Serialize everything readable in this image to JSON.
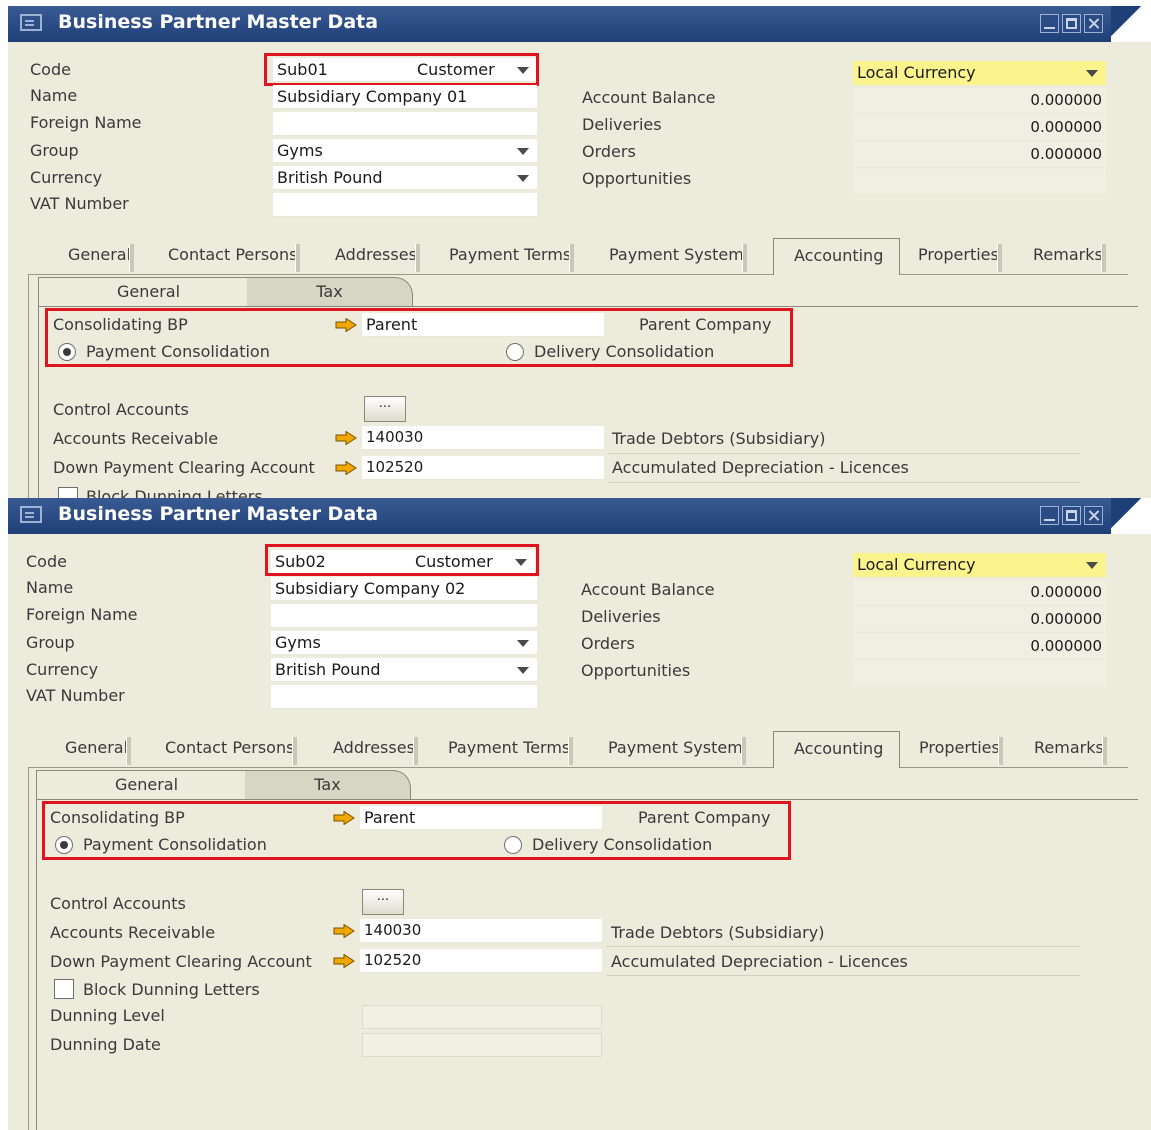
{
  "windows": [
    {
      "title": "Business Partner Master Data",
      "header": {
        "code_label": "Code",
        "code_value": "Sub01",
        "code_type": "Customer",
        "name_label": "Name",
        "name_value": "Subsidiary Company 01",
        "foreign_name_label": "Foreign Name",
        "foreign_name_value": "",
        "group_label": "Group",
        "group_value": "Gyms",
        "currency_label": "Currency",
        "currency_value": "British Pound",
        "vat_label": "VAT Number",
        "vat_value": "",
        "local_currency": "Local Currency",
        "account_balance_label": "Account Balance",
        "account_balance": "0.000000",
        "deliveries_label": "Deliveries",
        "deliveries": "0.000000",
        "orders_label": "Orders",
        "orders": "0.000000",
        "opportunities_label": "Opportunities",
        "opportunities": ""
      },
      "tabs": [
        "General",
        "Contact Persons",
        "Addresses",
        "Payment Terms",
        "Payment System",
        "Accounting",
        "Properties",
        "Remarks"
      ],
      "active_tab": "Accounting",
      "subtabs": [
        "General",
        "Tax"
      ],
      "consolidating": {
        "label": "Consolidating BP",
        "value": "Parent",
        "name": "Parent Company",
        "payment_label": "Payment Consolidation",
        "delivery_label": "Delivery Consolidation",
        "selected": "payment"
      },
      "control_accounts": {
        "label": "Control Accounts",
        "button": "...",
        "ar_label": "Accounts Receivable",
        "ar_value": "140030",
        "ar_desc": "Trade Debtors (Subsidiary)",
        "dp_label": "Down Payment Clearing Account",
        "dp_value": "102520",
        "dp_desc": "Accumulated Depreciation - Licences"
      },
      "block_dunning_label": "Block Dunning Letters"
    },
    {
      "title": "Business Partner Master Data",
      "header": {
        "code_label": "Code",
        "code_value": "Sub02",
        "code_type": "Customer",
        "name_label": "Name",
        "name_value": "Subsidiary Company 02",
        "foreign_name_label": "Foreign Name",
        "foreign_name_value": "",
        "group_label": "Group",
        "group_value": "Gyms",
        "currency_label": "Currency",
        "currency_value": "British Pound",
        "vat_label": "VAT Number",
        "vat_value": "",
        "local_currency": "Local Currency",
        "account_balance_label": "Account Balance",
        "account_balance": "0.000000",
        "deliveries_label": "Deliveries",
        "deliveries": "0.000000",
        "orders_label": "Orders",
        "orders": "0.000000",
        "opportunities_label": "Opportunities",
        "opportunities": ""
      },
      "tabs": [
        "General",
        "Contact Persons",
        "Addresses",
        "Payment Terms",
        "Payment System",
        "Accounting",
        "Properties",
        "Remarks"
      ],
      "active_tab": "Accounting",
      "subtabs": [
        "General",
        "Tax"
      ],
      "consolidating": {
        "label": "Consolidating BP",
        "value": "Parent",
        "name": "Parent Company",
        "payment_label": "Payment Consolidation",
        "delivery_label": "Delivery Consolidation",
        "selected": "payment"
      },
      "control_accounts": {
        "label": "Control Accounts",
        "button": "...",
        "ar_label": "Accounts Receivable",
        "ar_value": "140030",
        "ar_desc": "Trade Debtors (Subsidiary)",
        "dp_label": "Down Payment Clearing Account",
        "dp_value": "102520",
        "dp_desc": "Accumulated Depreciation - Licences"
      },
      "block_dunning_label": "Block Dunning Letters",
      "dunning_level_label": "Dunning Level",
      "dunning_level": "",
      "dunning_date_label": "Dunning Date",
      "dunning_date": ""
    }
  ],
  "colors": {
    "title_bar": "#1f3f78",
    "window_bg": "#ecebdc",
    "highlight_box": "#e0141d",
    "local_currency_bg": "#fbf48c",
    "link_arrow": "#f0a800"
  }
}
